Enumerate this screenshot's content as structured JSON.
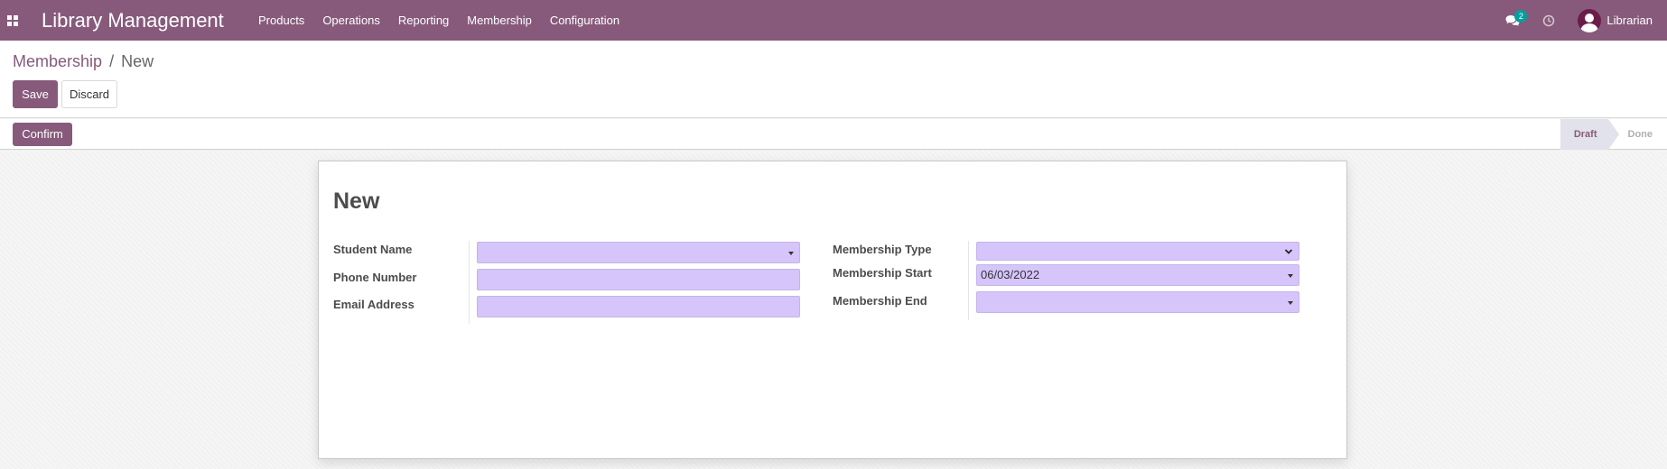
{
  "navbar": {
    "app_title": "Library Management",
    "menu": [
      "Products",
      "Operations",
      "Reporting",
      "Membership",
      "Configuration"
    ],
    "chat_badge": "2",
    "user_name": "Librarian",
    "accent_color": "#875a7b"
  },
  "control_panel": {
    "breadcrumb_parent": "Membership",
    "breadcrumb_separator": "/",
    "breadcrumb_current": "New",
    "save_label": "Save",
    "discard_label": "Discard"
  },
  "statusbar": {
    "confirm_label": "Confirm",
    "stages": [
      "Draft",
      "Done"
    ],
    "active_stage": "Draft"
  },
  "form": {
    "title": "New",
    "left_fields": [
      {
        "label": "Student Name",
        "value": "",
        "type": "many2one"
      },
      {
        "label": "Phone Number",
        "value": "",
        "type": "char"
      },
      {
        "label": "Email Address",
        "value": "",
        "type": "char"
      }
    ],
    "right_fields": [
      {
        "label": "Membership Type",
        "value": "",
        "type": "selection"
      },
      {
        "label": "Membership Start",
        "value": "06/03/2022",
        "type": "date"
      },
      {
        "label": "Membership End",
        "value": "",
        "type": "date"
      }
    ],
    "input_color": "#d6c5fb"
  }
}
